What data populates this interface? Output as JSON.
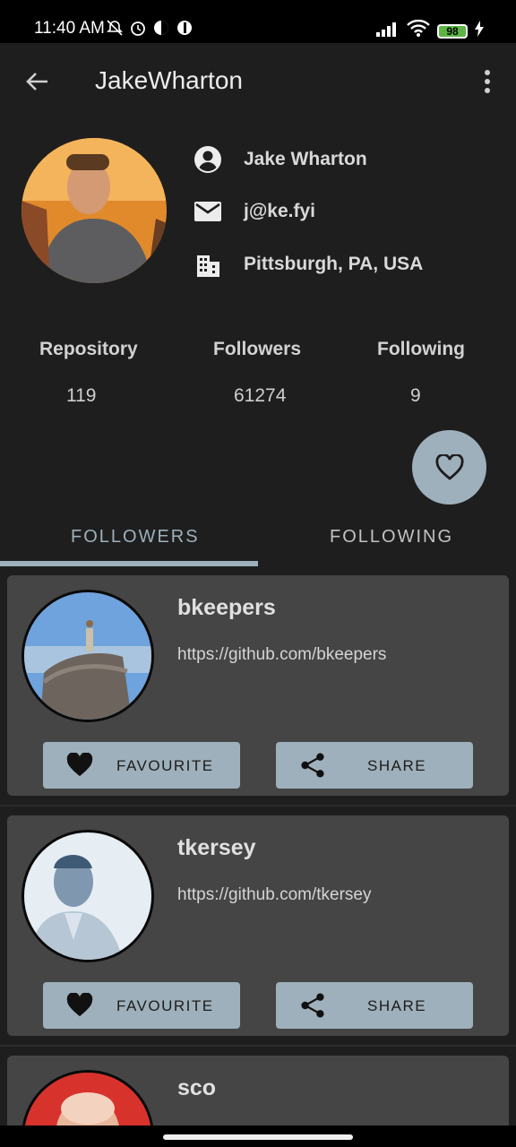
{
  "status_bar": {
    "time": "11:40 AM",
    "battery": "98"
  },
  "app_bar": {
    "title": "JakeWharton"
  },
  "profile": {
    "name": "Jake Wharton",
    "email": "j@ke.fyi",
    "location": "Pittsburgh, PA, USA"
  },
  "stats": [
    {
      "label": "Repository",
      "value": "119"
    },
    {
      "label": "Followers",
      "value": "61274"
    },
    {
      "label": "Following",
      "value": "9"
    }
  ],
  "tabs": [
    {
      "label": "FOLLOWERS",
      "selected": true
    },
    {
      "label": "FOLLOWING",
      "selected": false
    }
  ],
  "users": [
    {
      "login": "bkeepers",
      "url": "https://github.com/bkeepers",
      "favourite_label": "FAVOURITE",
      "share_label": "SHARE"
    },
    {
      "login": "tkersey",
      "url": "https://github.com/tkersey",
      "favourite_label": "FAVOURITE",
      "share_label": "SHARE"
    },
    {
      "login": "sco"
    }
  ],
  "colors": {
    "accent": "#9eb0bb",
    "card": "#454545",
    "background": "#1e1e1e"
  }
}
